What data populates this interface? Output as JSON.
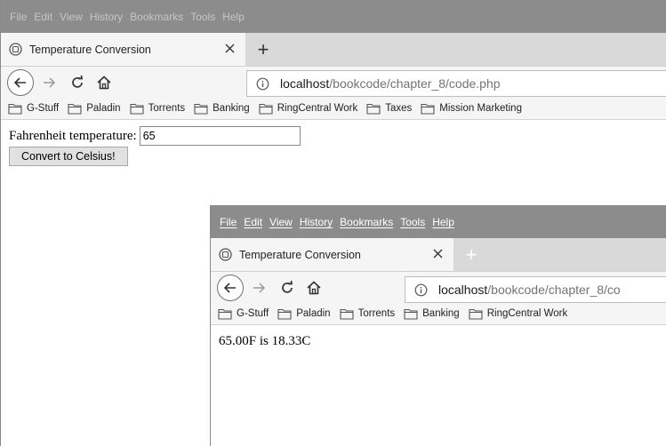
{
  "back_window": {
    "menu": [
      "File",
      "Edit",
      "View",
      "History",
      "Bookmarks",
      "Tools",
      "Help"
    ],
    "tab_title": "Temperature Conversion",
    "new_tab_symbol": "+",
    "url_host": "localhost",
    "url_path": "/bookcode/chapter_8/code.php",
    "bookmarks": [
      "G-Stuff",
      "Paladin",
      "Torrents",
      "Banking",
      "RingCentral Work",
      "Taxes",
      "Mission Marketing"
    ],
    "form": {
      "label": "Fahrenheit temperature:",
      "input_value": "65",
      "button_label": "Convert to Celsius!"
    }
  },
  "front_window": {
    "menu": [
      "File",
      "Edit",
      "View",
      "History",
      "Bookmarks",
      "Tools",
      "Help"
    ],
    "tab_title": "Temperature Conversion",
    "new_tab_symbol": "+",
    "url_host": "localhost",
    "url_path": "/bookcode/chapter_8/co",
    "bookmarks": [
      "G-Stuff",
      "Paladin",
      "Torrents",
      "Banking",
      "RingCentral Work"
    ],
    "result": "65.00F is 18.33C"
  },
  "icons": {
    "tab_favicon": "page-icon",
    "tab_close": "close-icon",
    "new_tab": "plus-icon",
    "back": "arrow-left-icon",
    "forward": "arrow-right-icon",
    "reload": "reload-icon",
    "home": "home-icon",
    "site_info": "info-icon",
    "bookmark_folder": "folder-icon"
  },
  "colors": {
    "menubar": "#8c8c8c",
    "tabstrip": "#d9d9d9",
    "toolbar": "#f5f5f5",
    "url_path_text": "#737373"
  }
}
